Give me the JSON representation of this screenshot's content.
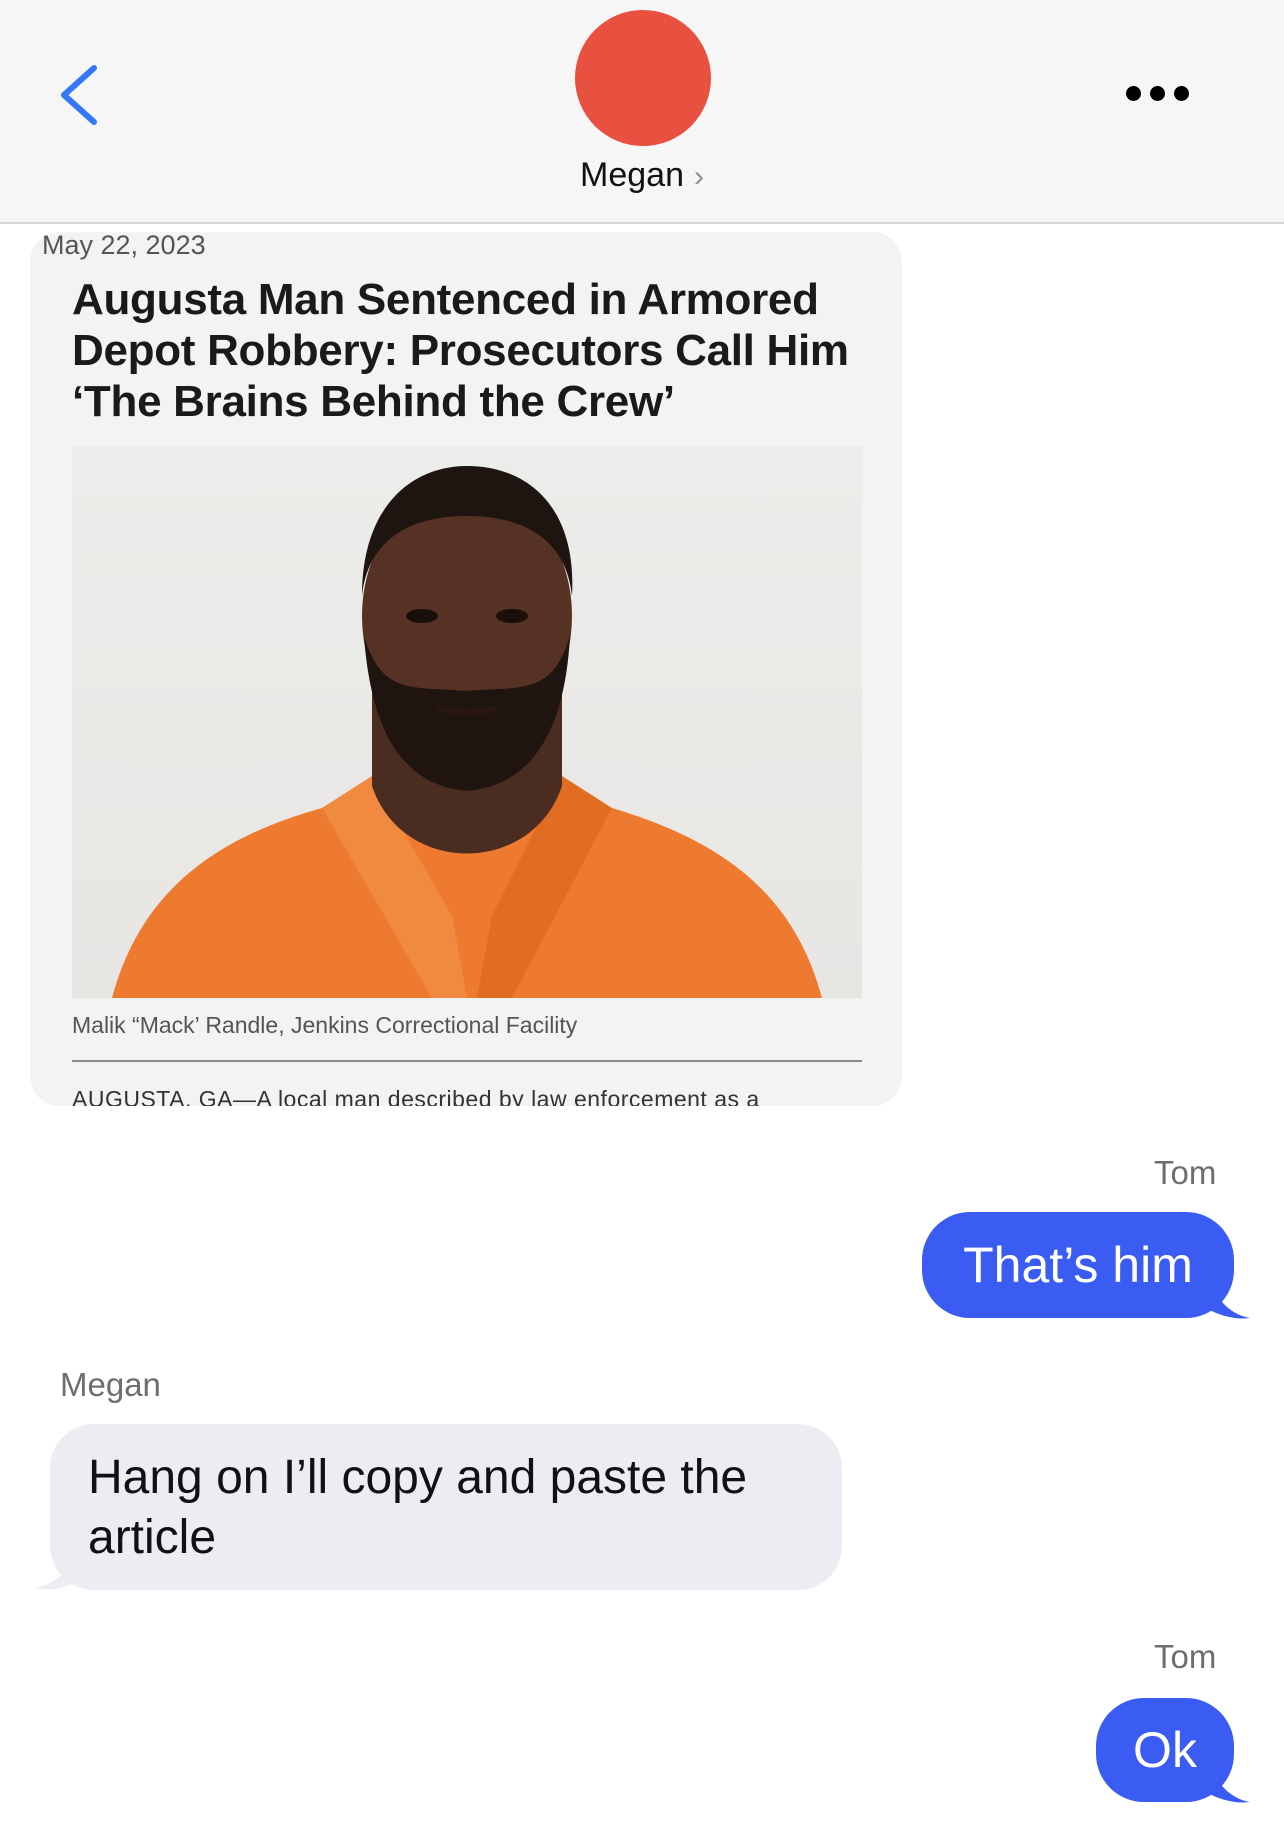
{
  "header": {
    "contact_name": "Megan",
    "contact_chevron": "›",
    "avatar_color": "#e8503f",
    "back_icon": "chevron-left-icon",
    "more_icon": "ellipsis-icon"
  },
  "conversation": {
    "date": "May 22, 2023",
    "article": {
      "headline": "Augusta Man Sentenced in Armored Depot Robbery: Prosecutors Call Him ‘The Brains Behind the Crew’",
      "caption": "Malik “Mack’ Randle, Jenkins Correctional Facility",
      "body_start": "AUGUSTA, GA—A local man described by law enforcement as a"
    },
    "messages": [
      {
        "sender": "Tom",
        "text": "That’s him",
        "direction": "outgoing"
      },
      {
        "sender": "Megan",
        "text": "Hang on I’ll copy and paste the article",
        "direction": "incoming"
      },
      {
        "sender": "Tom",
        "text": "Ok",
        "direction": "outgoing"
      }
    ]
  },
  "colors": {
    "outgoing_bubble": "#3b5cf2",
    "incoming_bubble": "#ececf2",
    "accent_blue": "#3478f6"
  }
}
